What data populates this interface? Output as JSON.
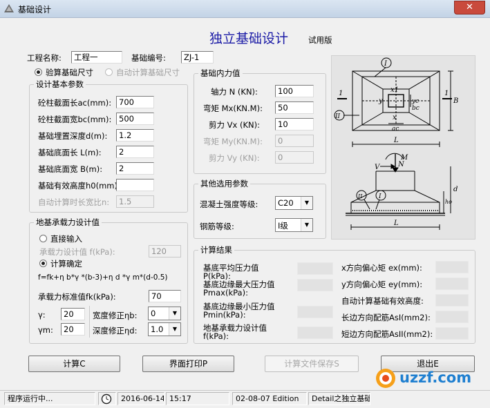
{
  "window": {
    "title": "基础设计",
    "close_glyph": "✕"
  },
  "header": {
    "title": "独立基础设计",
    "edition": "试用版"
  },
  "project": {
    "name_label": "工程名称:",
    "name_value": "工程一",
    "code_label": "基础编号:",
    "code_value": "ZJ-1"
  },
  "mode": {
    "check_label": "验算基础尺寸",
    "auto_label": "自动计算基础尺寸",
    "selected": "check"
  },
  "basic_params": {
    "title": "设计基本参数",
    "rows": [
      {
        "label": "砼柱截面长ac(mm):",
        "value": "700"
      },
      {
        "label": "砼柱截面宽bc(mm):",
        "value": "500"
      },
      {
        "label": "基础埋置深度d(m):",
        "value": "1.2"
      },
      {
        "label": "基础底面长  L(m):",
        "value": "2"
      },
      {
        "label": "基础底面宽  B(m):",
        "value": "2"
      },
      {
        "label": "基础有效高度h0(mm):",
        "value": ""
      }
    ],
    "ratio_label": "自动计算时长宽比n:",
    "ratio_value": "1.5"
  },
  "forces": {
    "title": "基础内力值",
    "rows": [
      {
        "label": "轴力 N (KN):",
        "value": "100",
        "enabled": true
      },
      {
        "label": "弯矩 Mx(KN.M):",
        "value": "50",
        "enabled": true
      },
      {
        "label": "剪力 Vx (KN):",
        "value": "10",
        "enabled": true
      },
      {
        "label": "弯矩 My(KN.M):",
        "value": "0",
        "enabled": false
      },
      {
        "label": "剪力 Vy (KN):",
        "value": "0",
        "enabled": false
      }
    ]
  },
  "other_params": {
    "title": "其他选用参数",
    "concrete_label": "混凝土强度等级:",
    "concrete_value": "C20",
    "rebar_label": "钢筋等级:",
    "rebar_value": "I级"
  },
  "bearing": {
    "title": "地基承载力设计值",
    "direct_label": "直接输入",
    "design_value_label": "承载力设计值 f(kPa):",
    "design_value": "120",
    "calc_label": "计算确定",
    "selected": "calc",
    "formula": "f=fk+η b*γ *(b-3)+η d *γ m*(d-0.5)",
    "std_label": "承载力标准值fk(kPa):",
    "std_value": "70",
    "gamma_label": "γ:",
    "gamma_value": "20",
    "gamma_m_label": "γm:",
    "gamma_m_value": "20",
    "eta_b_label": "宽度修正ηb:",
    "eta_b_value": "0",
    "eta_d_label": "深度修正ηd:",
    "eta_d_value": "1.0"
  },
  "results": {
    "title": "计算结果",
    "left": [
      {
        "label1": "基底平均压力值",
        "label2": "P(kPa):"
      },
      {
        "label1": "基底边缘最大压力值",
        "label2": "Pmax(kPa):"
      },
      {
        "label1": "基底边缘最小压力值",
        "label2": "Pmin(kPa):"
      },
      {
        "label1": "地基承载力设计值",
        "label2": "f(kPa):"
      }
    ],
    "right": [
      {
        "label": "x方向偏心矩 ex(mm):"
      },
      {
        "label": "y方向偏心矩 ey(mm):"
      },
      {
        "label": "自动计算基础有效高度:"
      },
      {
        "label": "长边方向配筋AsI(mm2):"
      },
      {
        "label": "短边方向配筋AsII(mm2):"
      }
    ]
  },
  "buttons": {
    "calc": "计算C",
    "print": "界面打印P",
    "save": "计算文件保存S",
    "exit": "退出E"
  },
  "statusbar": {
    "status": "程序运行中...",
    "date": "2016-06-14",
    "time": "15:17",
    "edition": "02-08-07 Edition",
    "detail": "Detail之独立基础设计"
  },
  "watermark": "uzzf.com",
  "diagram": {
    "plan_labels": {
      "section": "1",
      "circle_I": "I",
      "circle_II": "II",
      "x1": "x1",
      "y": "y",
      "yc": "yc",
      "bc": "bc",
      "x2": "x",
      "ac": "ac",
      "L": "L",
      "B": "B"
    },
    "section_labels": {
      "M": "M",
      "N": "N",
      "V": "V",
      "ho": "ho",
      "d": "d",
      "L": "L",
      "II": "II",
      "I": "I"
    }
  }
}
